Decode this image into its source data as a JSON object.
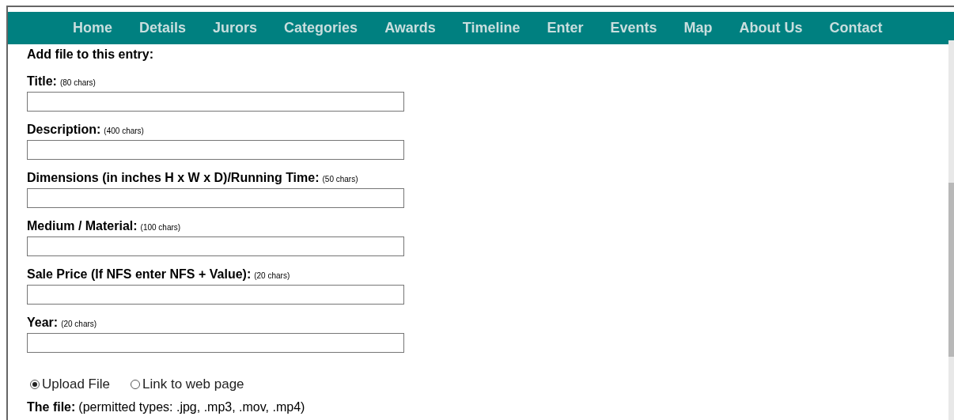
{
  "nav": [
    {
      "label": "Home"
    },
    {
      "label": "Details"
    },
    {
      "label": "Jurors"
    },
    {
      "label": "Categories"
    },
    {
      "label": "Awards"
    },
    {
      "label": "Timeline"
    },
    {
      "label": "Enter"
    },
    {
      "label": "Events"
    },
    {
      "label": "Map"
    },
    {
      "label": "About Us"
    },
    {
      "label": "Contact"
    }
  ],
  "heading": "Add file to this entry:",
  "fields": [
    {
      "label": "Title:",
      "hint": "(80 chars)"
    },
    {
      "label": "Description:",
      "hint": "(400 chars)"
    },
    {
      "label": "Dimensions (in inches H x W x D)/Running Time:",
      "hint": "(50 chars)"
    },
    {
      "label": "Medium / Material:",
      "hint": "(100 chars)"
    },
    {
      "label": "Sale Price (If NFS enter NFS + Value):",
      "hint": "(20 chars)"
    },
    {
      "label": "Year:",
      "hint": "(20 chars)"
    }
  ],
  "source_options": [
    {
      "label": "Upload File",
      "selected": true
    },
    {
      "label": "Link to web page",
      "selected": false
    }
  ],
  "file_line": {
    "label": "The file:",
    "note": "(permitted types: .jpg, .mp3, .mov, .mp4)"
  }
}
